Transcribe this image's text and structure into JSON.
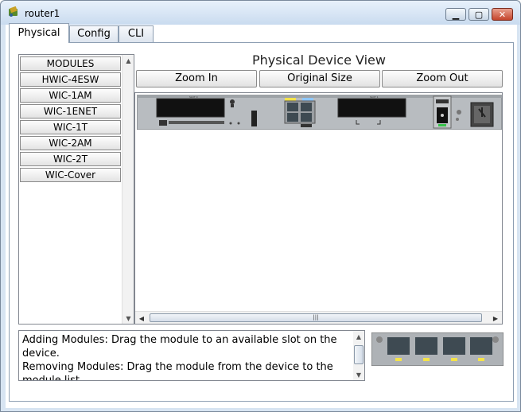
{
  "window": {
    "title": "router1"
  },
  "tabs": [
    {
      "label": "Physical",
      "active": true
    },
    {
      "label": "Config",
      "active": false
    },
    {
      "label": "CLI",
      "active": false
    }
  ],
  "modules": {
    "header": "MODULES",
    "items": [
      "HWIC-4ESW",
      "WIC-1AM",
      "WIC-1ENET",
      "WIC-1T",
      "WIC-2AM",
      "WIC-2T",
      "WIC-Cover"
    ]
  },
  "device_view": {
    "title": "Physical Device View",
    "zoom_in": "Zoom In",
    "original_size": "Original Size",
    "zoom_out": "Zoom Out"
  },
  "info": {
    "line1": "Adding Modules: Drag the module to an available slot on the device.",
    "line2": "Removing Modules: Drag the module from the device to the module list."
  },
  "colors": {
    "accent": "#3399ff",
    "panel_border": "#8e9fb3"
  }
}
